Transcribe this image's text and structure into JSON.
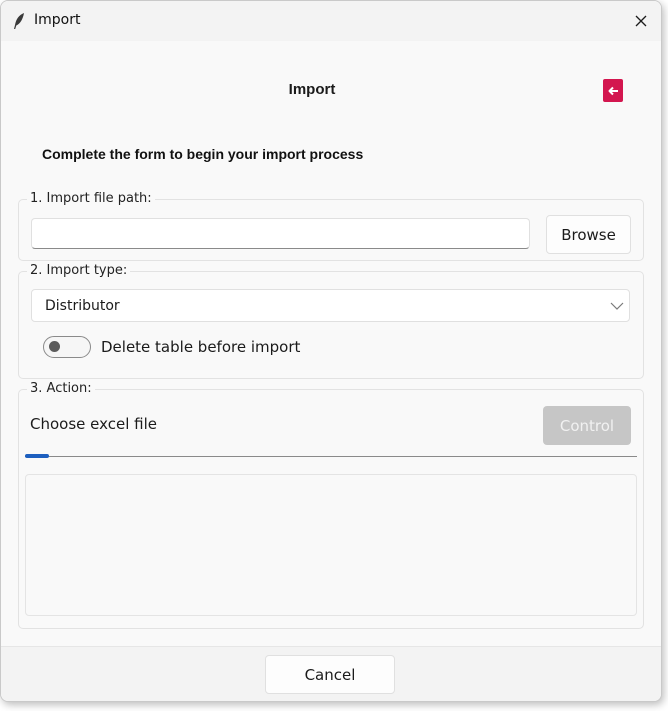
{
  "window": {
    "title": "Import",
    "icons": {
      "app": "feather-icon",
      "close": "close-icon"
    }
  },
  "header": {
    "title": "Import",
    "exit_icon": "exit-icon",
    "exit_color": "#d3164f"
  },
  "form": {
    "subtitle": "Complete the form to begin your import process",
    "file_path": {
      "label": "1. Import file path:",
      "value": "",
      "browse_label": "Browse"
    },
    "import_type": {
      "label": "2. Import type:",
      "selected": "Distributor",
      "chevron_icon": "chevron-down-icon",
      "toggle_label": "Delete table before import",
      "toggle_on": false
    },
    "action": {
      "label": "3. Action:",
      "status": "Choose excel file",
      "control_label": "Control",
      "progress": 0.04,
      "progress_color": "#1d5fbf",
      "log": ""
    }
  },
  "footer": {
    "cancel_label": "Cancel"
  }
}
